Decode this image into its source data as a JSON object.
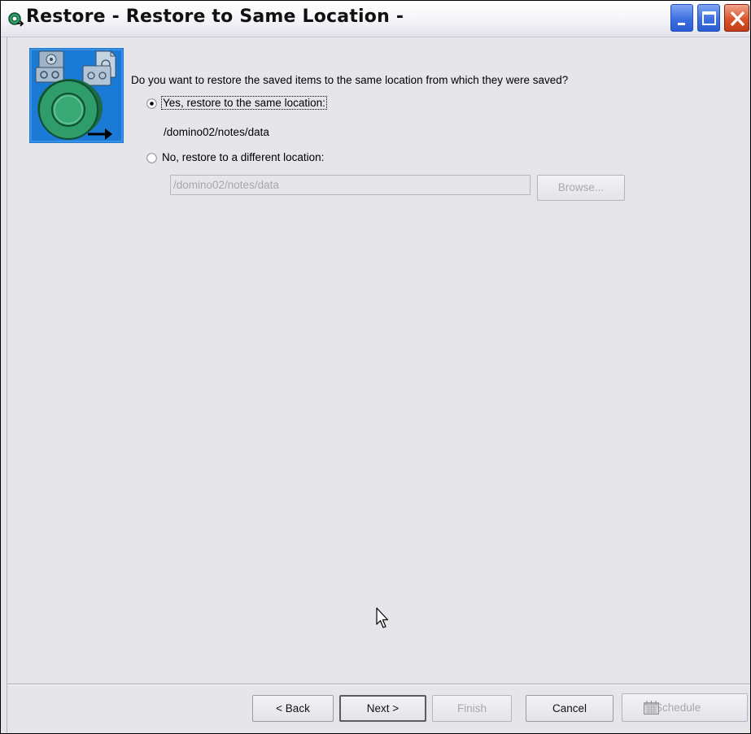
{
  "window": {
    "title": "Restore - Restore to Same Location -",
    "controls": [
      "minimize",
      "maximize",
      "close"
    ]
  },
  "wizard": {
    "question": "Do you want to restore the saved items to the same location from which they were saved?",
    "option_same": {
      "label": "Yes, restore to the same location:",
      "selected": true,
      "path": "/domino02/notes/data"
    },
    "option_different": {
      "label": "No, restore to a different location:",
      "selected": false,
      "path_value": "/domino02/notes/data",
      "browse_label": "Browse...",
      "enabled": false
    }
  },
  "footer": {
    "back_label": "< Back",
    "next_label": "Next >",
    "finish_label": "Finish",
    "cancel_label": "Cancel",
    "schedule_label": "Schedule"
  },
  "colors": {
    "window_background": "#e6e5ea",
    "title_close_button": "#d9542b",
    "title_buttons": "#3d6fe0",
    "wizard_image_background": "#1a7ad6",
    "wizard_image_reel": "#2f9d6a",
    "disabled_text": "#a9a8ae"
  },
  "icons": {
    "app": "restore-app-icon",
    "wizard": "tape-restore-wizard-image",
    "schedule": "calendar-icon",
    "cursor": "mouse-pointer-icon"
  }
}
